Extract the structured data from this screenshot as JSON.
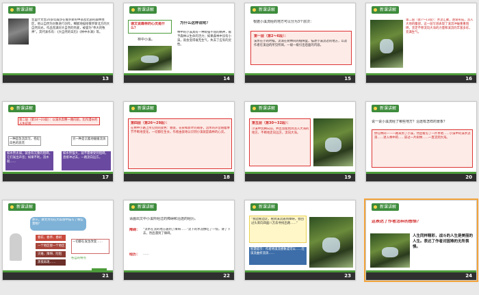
{
  "app": {
    "view": "slide-sorter"
  },
  "slides": [
    {
      "num": "13",
      "tag": "新课讲解",
      "body": "普里什文曾20多年跋涉在俄罗斯的中部及北部的森林地区，他以自然为对象进行创作，细腻地描绘俄罗斯北方的大自然风光，作品充满对大自然的热爱，被誉为“伟大的牧神”。其代表作有：《大自然的日历》《林中水滴》等。"
    },
    {
      "num": "14",
      "tag": "新课讲解",
      "question": "课文说森林的心灵是什么？",
      "caption": "林中小溪。",
      "heading": "为什么这样说呢？",
      "body": "林中的小溪具有一种顽强不屈的精神，赋予森林以生命的活力；如果森林中没有小溪，就会变得毫无生气，失去了应有的灵性。"
    },
    {
      "num": "15",
      "tag": "新课讲解",
      "heading": "根据小溪流经的地方可以分为3个层次：",
      "box_title": "第一层（第2～6段）：",
      "body": "溪水在小的时候，流淌在树林间的缝隙里，描述小溪流过的地方，以及作者在溪边的所见所闻，一级一级引出后面的内容。"
    },
    {
      "num": "16",
      "tag": "新课讲解",
      "body": "第二层（第7～13段）：水流汇聚，逐渐形成，流入大地的腹部，这一层写道表现了溪流冲破重重阻碍，坚定不移流向大海的力量和溪流的丰富多彩，充满生气。"
    },
    {
      "num": "17",
      "tag": "新课讲解",
      "top": "第二层（第14～23段）：以溪水奔腾一路向前，比作漫长的人生征程",
      "left": "一种是急流奔泻，卷起白色的浪花",
      "right": "另一种是沉着地缓缓流淌",
      "bl": "如水势太弱，就会有沉重的阻碍，它们发出声音；如果不利，流水就……",
      "br": "如水势强大，就不需要受到阻碍，直接冲过去，一路流向远方。"
    },
    {
      "num": "18",
      "tag": "新课讲解",
      "box_title": "第四层（第26～29段）：",
      "body": "在林中小路上所见到的景色：春景、花朵和新叶的萌芽，流水的声音随着季节不断地变化，一切都在生长，作者由衷地认识到小溪就是森林的心灵。"
    },
    {
      "num": "19",
      "tag": "新课讲解",
      "box_title": "第五层（第30～32段）：",
      "body": "小溪中奔腾向前，并且总能找到流入大海的地方，不断地走向远方，流向大海。"
    },
    {
      "num": "20",
      "tag": "新课讲解",
      "heading": "说一说小溪流经了哪些地方？沿途有怎样的景象？",
      "body": "你在林间——一路来到了小溪，然后看见了一片草地……小溪中的溪水流淌……进入林中的……穿过一片树林……一直流到大海。"
    },
    {
      "num": "21",
      "tag": "新课讲解",
      "intro": "那么，课文为何在大段落中描写了哪些景物？",
      "items": [
        "春花、春草、春树",
        "一个地区接一个地区",
        "灾难、障碍、险阻",
        "黑夜再现……"
      ],
      "note": "一切都在发生改变……",
      "extra": "各自的特点"
    },
    {
      "num": "22",
      "tag": "新课讲解",
      "heading": "请画出文中小溪所经过的障碍和沿途的经历。",
      "r1_label": "障碍：",
      "r1": "“流水在流的地方遇到了障碍……”流下的水流像吃了一惊，滑了下去，然后遇到了障碍。",
      "r2_label": "经历：",
      "r2": "……"
    },
    {
      "num": "23",
      "tag": "新课讲解",
      "body": "“我边看边走，看到溪流遇到障碍，会回过头来向四面八方去寻找出路……”",
      "caption": "智慧提示：作者将溪流想象成可以……在溪流曲折流淌……"
    },
    {
      "num": "24",
      "tag": "新课讲解",
      "question": "这表达了作者怎样的感悟？",
      "body": "人生同样精彩，战斗的人生是美丽的人生。表达了作者对困难的无所畏惧。"
    }
  ]
}
